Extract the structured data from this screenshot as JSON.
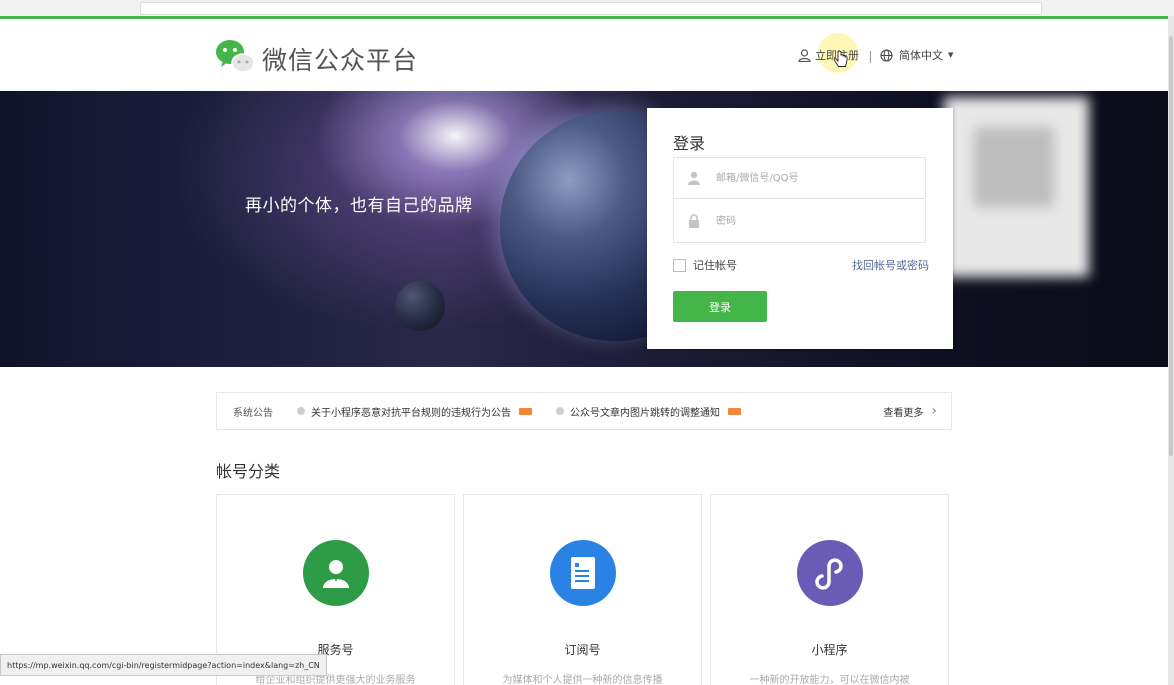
{
  "header": {
    "logo_text": "微信公众平台",
    "register_label": "立即注册",
    "language_label": "简体中文"
  },
  "banner": {
    "slogan": "再小的个体，也有自己的品牌"
  },
  "login": {
    "title": "登录",
    "account_placeholder": "邮箱/微信号/QQ号",
    "password_placeholder": "密码",
    "remember_label": "记住帐号",
    "forgot_label": "找回帐号或密码",
    "submit_label": "登录"
  },
  "notices": {
    "label": "系统公告",
    "items": [
      "关于小程序恶意对抗平台规则的违规行为公告",
      "公众号文章内图片跳转的调整通知"
    ],
    "more_label": "查看更多"
  },
  "accounts": {
    "title": "帐号分类",
    "cards": [
      {
        "title": "服务号",
        "desc": "给企业和组织提供更强大的业务服务",
        "color": "#2e9b47"
      },
      {
        "title": "订阅号",
        "desc": "为媒体和个人提供一种新的信息传播",
        "color": "#2a82e4"
      },
      {
        "title": "小程序",
        "desc": "一种新的开放能力，可以在微信内被",
        "color": "#6a5cb6"
      }
    ]
  },
  "status_url": "https://mp.weixin.qq.com/cgi-bin/registermidpage?action=index&lang=zh_CN"
}
